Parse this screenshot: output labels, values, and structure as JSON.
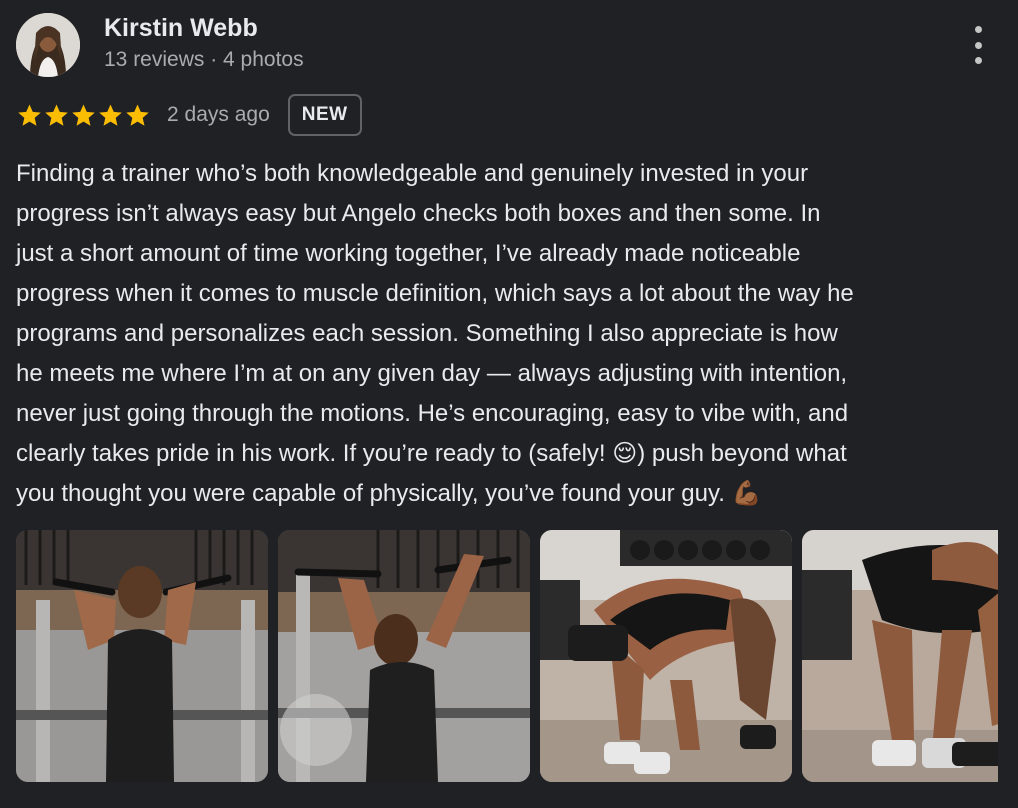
{
  "reviewer": {
    "name": "Kirstin Webb",
    "meta": "13 reviews · 4 photos"
  },
  "review": {
    "rating": 5,
    "date": "2 days ago",
    "badge": "NEW",
    "lines": [
      "Finding a trainer who’s both knowledgeable and genuinely invested in your",
      "progress isn’t always easy but Angelo checks both boxes and then some. In",
      "just a short amount of time working together, I’ve already made noticeable",
      "progress when it comes to muscle definition, which says a lot about the way he",
      "programs and personalizes each session. Something I also appreciate is how",
      "he meets me where I’m at on any given day — always adjusting with intention,",
      "never just going through the motions. He’s encouraging, easy to vibe with, and",
      "clearly takes pride in his work. If you’re ready to (safely! 😌) push beyond what",
      "you thought you were capable of physically, you’ve found your guy. 💪🏾"
    ]
  },
  "colors": {
    "background": "#202124",
    "star": "#fbbc04",
    "text": "#e8eaed",
    "secondary_text": "#a8acb0"
  },
  "icons": {
    "more": "more-vert-icon",
    "star": "star-icon"
  }
}
